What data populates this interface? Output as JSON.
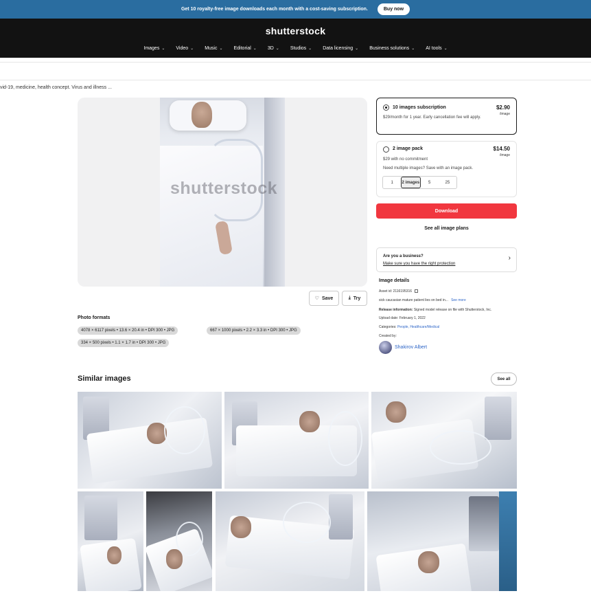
{
  "promo": {
    "text": "Get 10 royalty-free image downloads each month with a cost-saving subscription.",
    "button": "Buy now"
  },
  "header": {
    "logo": "shutterstock",
    "nav": [
      "Images",
      "Video",
      "Music",
      "Editorial",
      "3D",
      "Studios",
      "Data licensing",
      "Business solutions",
      "AI tools"
    ]
  },
  "breadcrumb": "vid-19, medicine, health concept. Virus and illness ...",
  "main_image": {
    "watermark": "shutterstock",
    "save_label": "Save",
    "try_label": "Try"
  },
  "formats": {
    "title": "Photo formats",
    "items": [
      "4078 × 6117 pixels • 13.6 × 20.4 in • DPI 300 • JPG",
      "667 × 1000 pixels • 2.2 × 3.3 in • DPI 300 • JPG",
      "334 × 500 pixels • 1.1 × 1.7 in • DPI 300 • JPG"
    ]
  },
  "plans": {
    "subscription": {
      "title": "10 images subscription",
      "price": "$2.90",
      "unit": "/image",
      "desc": "$29/month for 1 year. Early cancellation fee will apply."
    },
    "pack": {
      "title": "2 image pack",
      "price": "$14.50",
      "unit": "/image",
      "desc1": "$29 with no commitment",
      "desc2": "Need multiple images? Save with an image pack.",
      "options": [
        "1",
        "2 images",
        "5",
        "25"
      ]
    }
  },
  "download_label": "Download",
  "see_plans_label": "See all image plans",
  "business": {
    "title": "Are you a business?",
    "link": "Make sure you have the right protection"
  },
  "details": {
    "title": "Image details",
    "asset_id": "Asset id: 2116195316",
    "description": "sick caucasian mature patient lies on bed in...",
    "see_more": "See more",
    "release_label": "Release information:",
    "release_value": "Signed model release on file with Shutterstock, Inc.",
    "upload_date": "Upload date: February 1, 2022",
    "categories_label": "Categories:",
    "categories_value": "People, Healthcare/Medical",
    "created_by": "Created by:",
    "author": "Shakirov Albert"
  },
  "similar": {
    "title": "Similar images",
    "see_all": "See all"
  }
}
